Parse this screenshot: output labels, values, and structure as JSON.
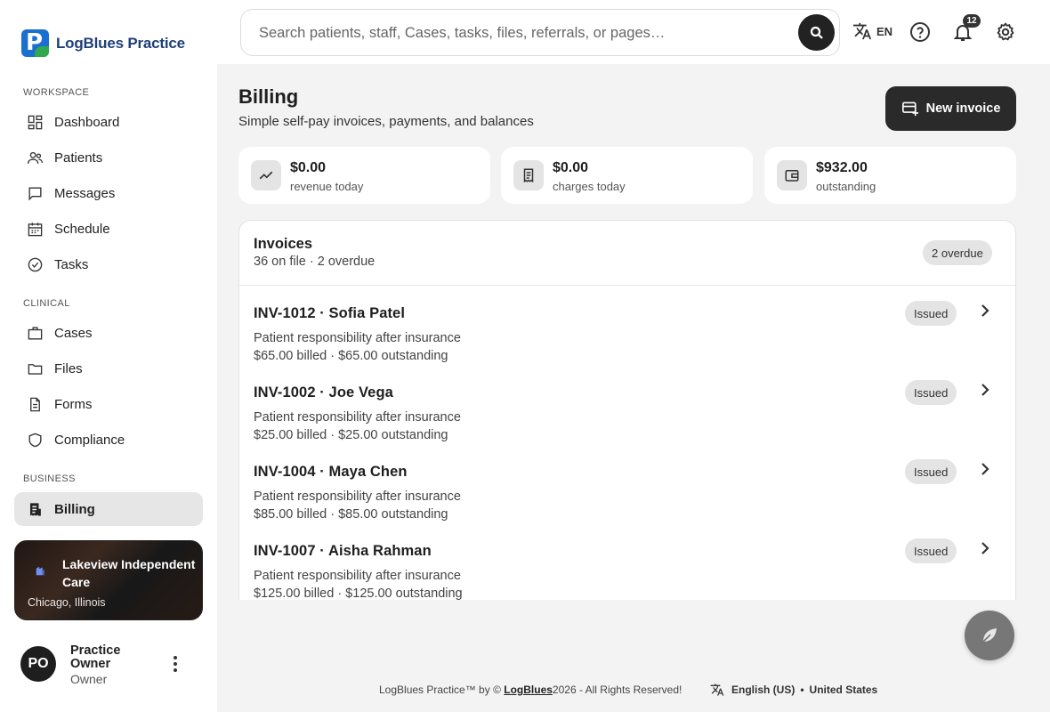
{
  "brand": {
    "name": "LogBlues Practice"
  },
  "sidebar": {
    "sections": {
      "workspace": "WORKSPACE",
      "clinical": "CLINICAL",
      "business": "BUSINESS"
    },
    "items": {
      "dashboard": "Dashboard",
      "patients": "Patients",
      "messages": "Messages",
      "schedule": "Schedule",
      "tasks": "Tasks",
      "cases": "Cases",
      "files": "Files",
      "forms": "Forms",
      "compliance": "Compliance",
      "billing": "Billing"
    },
    "active": "billing",
    "practice": {
      "name": "Lakeview Independent Care",
      "location": "Chicago, Illinois"
    },
    "user": {
      "initials": "PO",
      "name": "Practice Owner",
      "role": "Owner"
    }
  },
  "topbar": {
    "search_placeholder": "Search patients, staff, Cases, tasks, files, referrals, or pages…",
    "language": "EN",
    "notifications_count": "12",
    "icons": [
      "translate-icon",
      "help-icon",
      "bell-icon",
      "gear-icon"
    ]
  },
  "page": {
    "title": "Billing",
    "subtitle": "Simple self-pay invoices, payments, and balances",
    "new_invoice_label": "New invoice"
  },
  "stats": [
    {
      "value": "$0.00",
      "label": "revenue today",
      "icon": "trend-icon"
    },
    {
      "value": "$0.00",
      "label": "charges today",
      "icon": "receipt-icon"
    },
    {
      "value": "$932.00",
      "label": "outstanding",
      "icon": "wallet-icon"
    }
  ],
  "invoices": {
    "title": "Invoices",
    "subtitle": "36 on file · 2 overdue",
    "overdue_badge": "2 overdue",
    "rows": [
      {
        "title": "INV-1012 · Sofia Patel",
        "desc": "Patient responsibility after insurance",
        "amounts": "$65.00 billed · $65.00 outstanding",
        "status": "Issued"
      },
      {
        "title": "INV-1002 · Joe Vega",
        "desc": "Patient responsibility after insurance",
        "amounts": "$25.00 billed · $25.00 outstanding",
        "status": "Issued"
      },
      {
        "title": "INV-1004 · Maya Chen",
        "desc": "Patient responsibility after insurance",
        "amounts": "$85.00 billed · $85.00 outstanding",
        "status": "Issued"
      },
      {
        "title": "INV-1007 · Aisha Rahman",
        "desc": "Patient responsibility after insurance",
        "amounts": "$125.00 billed · $125.00 outstanding",
        "status": "Issued"
      }
    ]
  },
  "footer": {
    "prefix": "LogBlues Practice™ by © ",
    "brand": "LogBlues",
    "suffix": " 2026 - All Rights Reserved!",
    "language": "English (US)",
    "separator": "•",
    "country": "United States"
  },
  "colors": {
    "primary_dark": "#2a2a2a",
    "brand_blue": "#1a6fd0",
    "brand_green": "#2fa84f",
    "surface": "#ffffff",
    "background": "#f3f3f3"
  }
}
